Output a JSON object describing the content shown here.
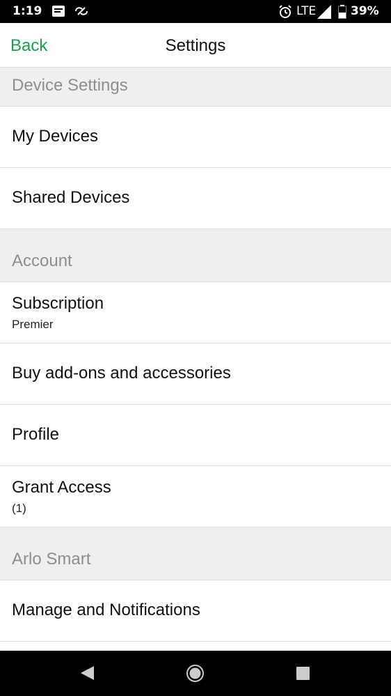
{
  "status_bar": {
    "time": "1:19",
    "network": "LTE",
    "battery": "39%",
    "icons": [
      "message-icon",
      "link-icon",
      "alarm-icon",
      "signal-icon",
      "battery-icon"
    ]
  },
  "header": {
    "back_label": "Back",
    "title": "Settings",
    "accent_color": "#1aa051"
  },
  "sections": {
    "device_settings": {
      "header": "Device Settings",
      "items": [
        {
          "title": "My Devices"
        },
        {
          "title": "Shared Devices"
        }
      ]
    },
    "account": {
      "header": "Account",
      "items": [
        {
          "title": "Subscription",
          "subtitle": "Premier"
        },
        {
          "title": "Buy add-ons and accessories"
        },
        {
          "title": "Profile"
        },
        {
          "title": "Grant Access",
          "subtitle": "(1)"
        }
      ]
    },
    "arlo_smart": {
      "header": "Arlo Smart",
      "items": [
        {
          "title": "Manage and Notifications"
        }
      ]
    }
  },
  "nav_bar": {
    "buttons": [
      "back-nav-icon",
      "home-nav-icon",
      "recents-nav-icon"
    ]
  }
}
